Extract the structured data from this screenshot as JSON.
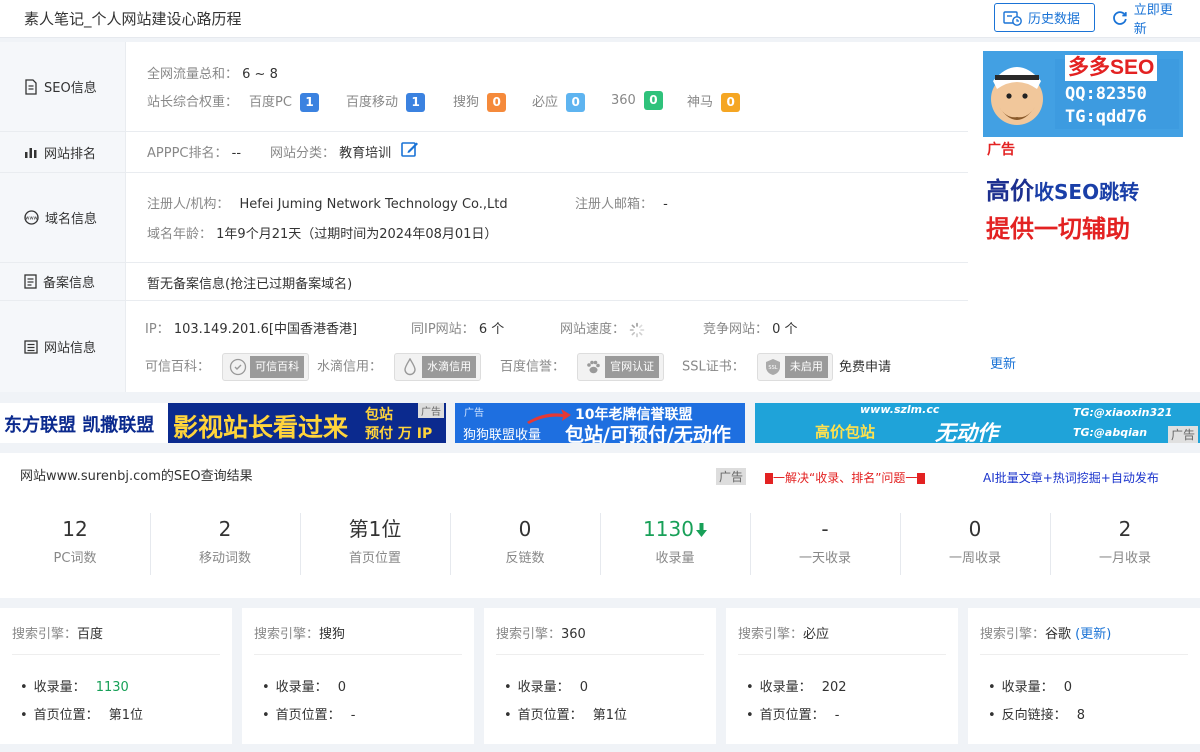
{
  "header": {
    "title": "素人笔记_个人网站建设心路历程",
    "history_btn": "历史数据",
    "update_btn": "立即更新"
  },
  "seo": {
    "label": "SEO信息",
    "traffic_key": "全网流量总和：",
    "traffic_val": "6 ~ 8",
    "weight_key": "站长综合权重：",
    "weights": [
      {
        "name": "百度PC",
        "value": "1",
        "color": "#3b82e0"
      },
      {
        "name": "百度移动",
        "value": "1",
        "color": "#3b82e0"
      },
      {
        "name": "搜狗",
        "value": "0",
        "color": "#f58a3b"
      },
      {
        "name": "必应",
        "value": "0",
        "color": "#5eb4f0"
      },
      {
        "name": "360",
        "value": "0",
        "color": "#2fc27b"
      },
      {
        "name": "神马",
        "value": "0",
        "color": "#f5a623"
      }
    ]
  },
  "rank": {
    "label": "网站排名",
    "apppc_key": "APPPC排名：",
    "apppc_val": "--",
    "cat_key": "网站分类：",
    "cat_val": "教育培训"
  },
  "domain": {
    "label": "域名信息",
    "org_key": "注册人/机构：",
    "org_val": "Hefei Juming Network Technology Co.,Ltd",
    "email_key": "注册人邮箱：",
    "email_val": "-",
    "age_key": "域名年龄：",
    "age_val": "1年9个月21天（过期时间为2024年08月01日）"
  },
  "icp": {
    "label": "备案信息",
    "text": "暂无备案信息(抢注已过期备案域名)"
  },
  "site": {
    "label": "网站信息",
    "ip_key": "IP：",
    "ip_val": "103.149.201.6[中国香港香港]",
    "sameip_key": "同IP网站：",
    "sameip_val": "6 个",
    "speed_key": "网站速度：",
    "compete_key": "竞争网站：",
    "compete_val": "0 个",
    "kexin_key": "可信百科：",
    "kexin_chip": "可信百科",
    "shuidi_key": "水滴信用：",
    "shuidi_chip": "水滴信用",
    "baidu_key": "百度信誉：",
    "baidu_chip": "官网认证",
    "ssl_key": "SSL证书：",
    "ssl_chip": "未启用",
    "ssl_apply": "免费申请",
    "refresh": "更新"
  },
  "side_ad": {
    "line1": "多多SEO",
    "qq": "QQ:82350",
    "tg": "TG:qdd76",
    "tag": "广告",
    "line2a": "高价",
    "line2b": "收SEO跳转",
    "line3": "提供一切辅助"
  },
  "banners": {
    "b1_left": "东方联盟 凯撒联盟",
    "b1_mid": "影视站长看过来",
    "b1_r1": "包站",
    "b1_r2": "预付 万 IP",
    "b1_tag": "广告",
    "b2_tag": "广告",
    "b2_top": "10年老牌信誉联盟",
    "b2_left": "狗狗联盟收量",
    "b2_right": "包站/可预付/无动作",
    "b3_url": "www.szlm.cc",
    "b3_left": "高价包站",
    "b3_mid": "无动作",
    "b3_tg1": "TG:@xiaoxin321",
    "b3_tg2": "TG:@abqian",
    "b3_tag": "广告"
  },
  "result": {
    "heading": "网站www.surenbj.com的SEO查询结果",
    "ad_tag": "广告",
    "ad_red": "一解决“收录、排名”问题一",
    "ad_blue": "AI批量文章+热词挖掘+自动发布"
  },
  "stats": [
    {
      "value": "12",
      "label": "PC词数"
    },
    {
      "value": "2",
      "label": "移动词数"
    },
    {
      "value": "第1位",
      "label": "首页位置"
    },
    {
      "value": "0",
      "label": "反链数"
    },
    {
      "value": "1130",
      "label": "收录量",
      "arrow": "down"
    },
    {
      "value": "-",
      "label": "一天收录"
    },
    {
      "value": "0",
      "label": "一周收录"
    },
    {
      "value": "2",
      "label": "一月收录"
    }
  ],
  "engines": [
    {
      "title_key": "搜索引擎：",
      "title": "百度",
      "r1k": "收录量：",
      "r1v": "1130",
      "r2k": "首页位置：",
      "r2v": "第1位"
    },
    {
      "title_key": "搜索引擎：",
      "title": "搜狗",
      "r1k": "收录量：",
      "r1v": "0",
      "r2k": "首页位置：",
      "r2v": "-"
    },
    {
      "title_key": "搜索引擎：",
      "title": "360",
      "r1k": "收录量：",
      "r1v": "0",
      "r2k": "首页位置：",
      "r2v": "第1位"
    },
    {
      "title_key": "搜索引擎：",
      "title": "必应",
      "r1k": "收录量：",
      "r1v": "202",
      "r2k": "首页位置：",
      "r2v": "-"
    },
    {
      "title_key": "搜索引擎：",
      "title": "谷歌",
      "extra": "(更新)",
      "r1k": "收录量：",
      "r1v": "0",
      "r2k": "反向链接：",
      "r2v": "8"
    }
  ]
}
